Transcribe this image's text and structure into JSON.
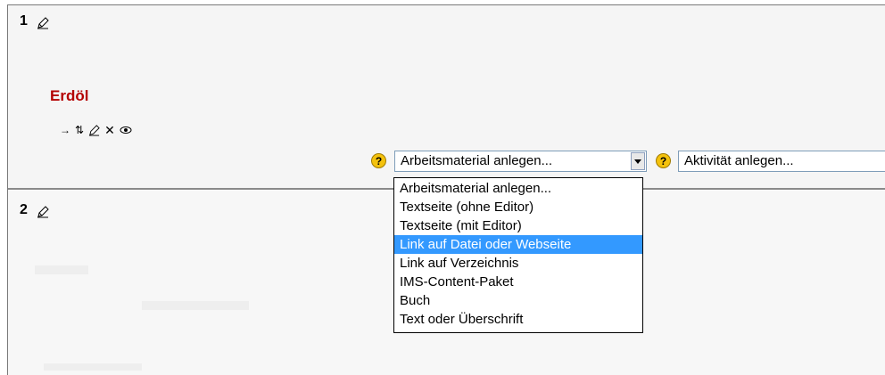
{
  "sections": [
    {
      "number": "1",
      "title": "Erdöl"
    },
    {
      "number": "2"
    }
  ],
  "icons": {
    "move": "→",
    "move_vertical": "⇅",
    "edit": "edit-icon",
    "delete": "✕",
    "visible": "eye-icon",
    "help": "?"
  },
  "resource_select": {
    "value": "Arbeitsmaterial anlegen...",
    "options": [
      "Arbeitsmaterial anlegen...",
      "Textseite (ohne Editor)",
      "Textseite (mit Editor)",
      "Link auf Datei oder Webseite",
      "Link auf Verzeichnis",
      "IMS-Content-Paket",
      "Buch",
      "Text oder Überschrift"
    ],
    "highlighted_option": "Link auf Datei oder Webseite"
  },
  "activity_select": {
    "value": "Aktivität anlegen..."
  },
  "colors": {
    "section_title": "#b40000",
    "highlight": "#3399ff",
    "help_icon": "#f4c20d"
  }
}
